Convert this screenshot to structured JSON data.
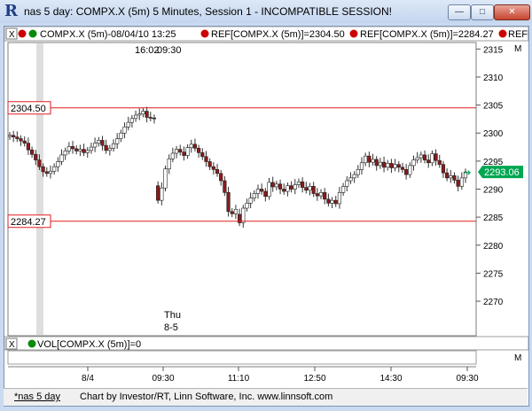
{
  "window": {
    "title": "nas 5 day: COMPX.X (5m) 5 Minutes, Session 1 - INCOMPATIBLE SESSION!",
    "logo_text": "R",
    "minimize_glyph": "—",
    "maximize_glyph": "□",
    "close_glyph": "✕"
  },
  "legend": {
    "main_symbol": "COMPX.X (5m)-08/04/10 13:25",
    "ref1": "REF[COMPX.X (5m)]=2304.50",
    "ref2": "REF[COMPX.X (5m)]=2284.27",
    "ref3": "REF[",
    "pane_tag": "M",
    "close_x": "X"
  },
  "cursor": {
    "time": "16:02",
    "bar_time": "09:30"
  },
  "day_label": {
    "weekday": "Thu",
    "date": "8-5"
  },
  "ref_lines": [
    {
      "label": "2304.50",
      "value": 2304.5
    },
    {
      "label": "2284.27",
      "value": 2284.27
    }
  ],
  "last_price": {
    "label": "2293.06",
    "value": 2293.06
  },
  "vol_legend": {
    "text": "VOL[COMPX.X (5m)]=0",
    "pane_tag": "M",
    "close_x": "X"
  },
  "xaxis": {
    "labels": [
      "8/4",
      "09:30",
      "11:10",
      "12:50",
      "14:30",
      "09:30"
    ]
  },
  "status": {
    "tab": "*nas 5 day",
    "credit": "Chart by Investor/RT, Linn Software, Inc. www.linnsoft.com"
  },
  "colors": {
    "ref_line": "#e01e1e",
    "bull_candle": "#ffffff",
    "bear_candle": "#8b1a1a",
    "last_price_bg": "#00a651",
    "session_band": "#dedede"
  },
  "chart_data": {
    "type": "candlestick",
    "symbol": "COMPX.X",
    "interval": "5 Minutes",
    "ylim": [
      2264,
      2316
    ],
    "yticks": [
      2270,
      2275,
      2280,
      2285,
      2290,
      2295,
      2300,
      2305,
      2310,
      2315
    ],
    "closes": [
      2299.6,
      2299.3,
      2299.0,
      2298.6,
      2298.2,
      2297.0,
      2296.2,
      2295.2,
      2294.0,
      2293.1,
      2292.8,
      2293.2,
      2294.0,
      2294.9,
      2296.1,
      2296.8,
      2297.6,
      2297.2,
      2296.8,
      2297.1,
      2296.5,
      2296.9,
      2297.5,
      2298.2,
      2298.7,
      2297.8,
      2296.9,
      2297.3,
      2298.1,
      2299.0,
      2300.0,
      2301.1,
      2301.9,
      2302.6,
      2303.2,
      2303.4,
      2303.9,
      2302.8,
      2302.7,
      2302.6,
      2288.0,
      2290.2,
      2293.6,
      2295.4,
      2296.4,
      2297.1,
      2296.6,
      2296.0,
      2297.4,
      2298.0,
      2297.3,
      2296.5,
      2295.8,
      2294.9,
      2294.0,
      2293.5,
      2292.8,
      2291.5,
      2289.4,
      2286.0,
      2285.6,
      2286.4,
      2284.0,
      2286.6,
      2287.5,
      2288.4,
      2289.2,
      2290.0,
      2289.6,
      2288.7,
      2291.2,
      2290.4,
      2290.9,
      2290.0,
      2289.6,
      2290.6,
      2290.0,
      2290.8,
      2291.3,
      2290.3,
      2289.8,
      2290.5,
      2289.2,
      2288.8,
      2289.4,
      2288.2,
      2287.5,
      2288.0,
      2287.4,
      2289.4,
      2290.5,
      2291.5,
      2292.0,
      2292.6,
      2293.5,
      2294.7,
      2295.9,
      2294.8,
      2295.3,
      2294.2,
      2294.8,
      2293.9,
      2294.6,
      2293.8,
      2294.4,
      2293.9,
      2293.5,
      2292.6,
      2294.2,
      2295.2,
      2295.6,
      2296.1,
      2295.2,
      2294.7,
      2296.3,
      2295.1,
      2294.4,
      2292.9,
      2292.0,
      2292.4,
      2291.6,
      2290.5,
      2292.0,
      2293.06
    ]
  }
}
